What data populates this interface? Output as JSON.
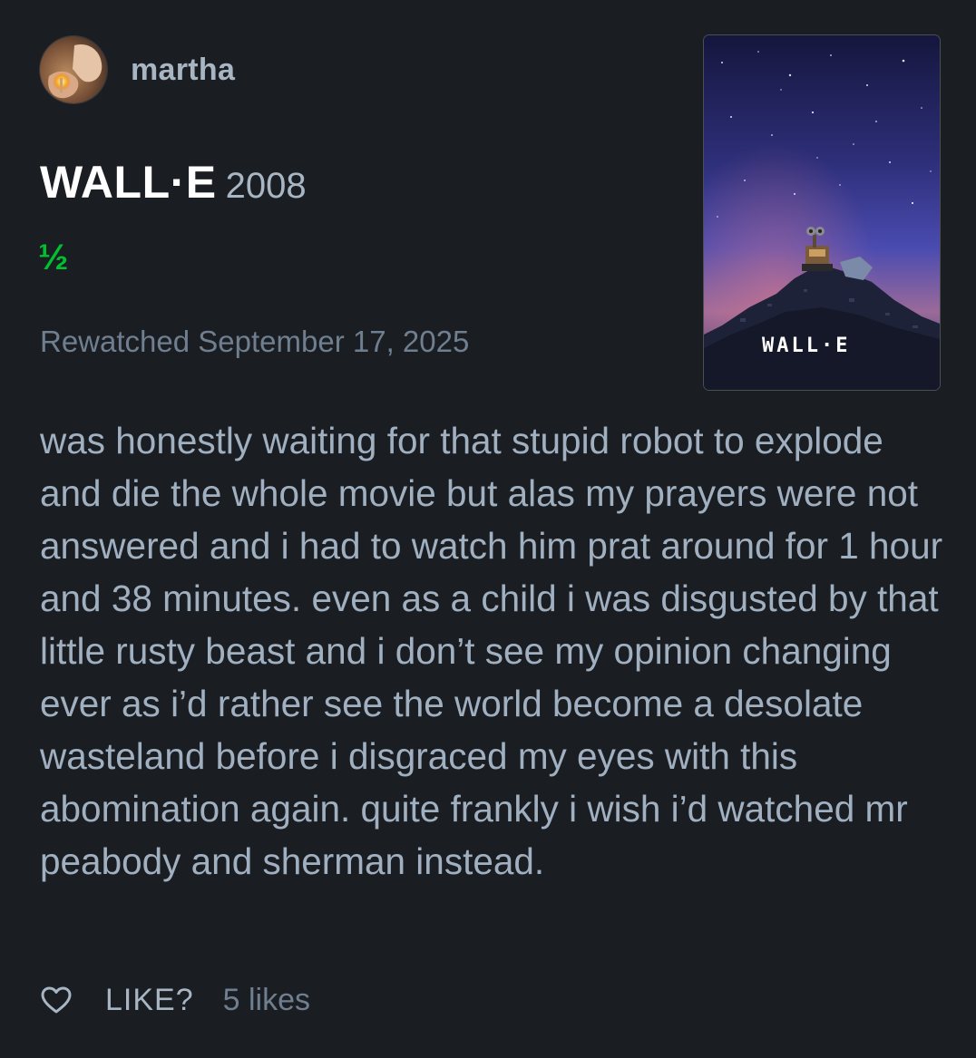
{
  "user": {
    "name": "martha"
  },
  "film": {
    "title": "WALL·E",
    "year": "2008"
  },
  "rating": "½",
  "watched_text": "Rewatched September 17, 2025",
  "poster": {
    "logo_text": "WALL·E"
  },
  "review_text": "was honestly waiting for that stupid robot to explode and die the whole movie but alas my prayers were not answered and i had to watch him prat around for 1 hour and 38 minutes. even as a child i was disgusted by that little rusty beast and i don’t see my opinion changing ever as i’d rather see the world become a desolate wasteland before i disgraced my eyes with this abomination again. quite frankly i wish i’d watched mr peabody and sherman instead.",
  "footer": {
    "like_label": "LIKE?",
    "likes_count": "5 likes"
  },
  "icons": {
    "like": "heart-outline-icon"
  },
  "colors": {
    "background": "#1a1d22",
    "rating_green": "#00c030",
    "text_primary": "#ffffff",
    "text_secondary": "#a0b0c0",
    "text_muted": "#6f7f8f"
  }
}
